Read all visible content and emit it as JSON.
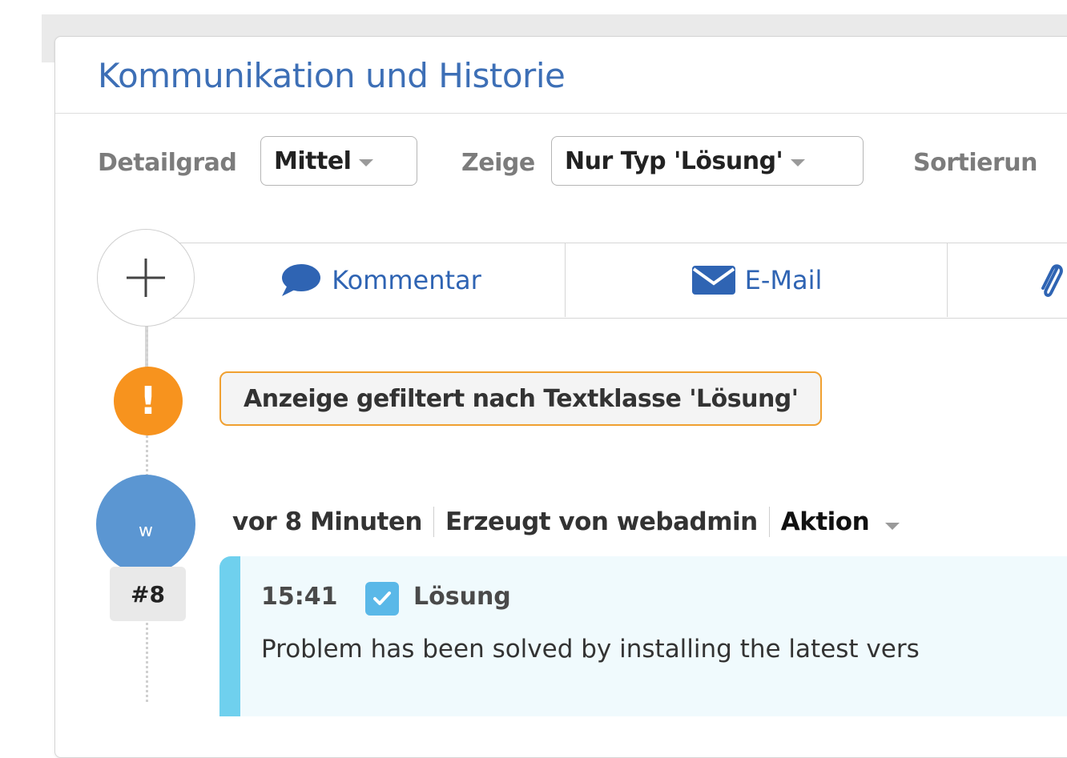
{
  "header": {
    "title": "Kommunikation und Historie"
  },
  "filters": {
    "detail_label": "Detailgrad",
    "detail_value": "Mittel",
    "show_label": "Zeige",
    "show_value": "Nur Typ 'Lösung'",
    "sort_label": "Sortierun"
  },
  "toolbar": {
    "comment_label": "Kommentar",
    "email_label": "E-Mail"
  },
  "notice": {
    "text": "Anzeige gefiltert nach Textklasse 'Lösung'",
    "icon_text": "!"
  },
  "entry": {
    "avatar_initial": "w",
    "number": "#8",
    "relative_time": "vor 8 Minuten",
    "created_by": "Erzeugt von webadmin",
    "action_label": "Aktion",
    "time": "15:41",
    "type": "Lösung",
    "text": "Problem has been solved by installing the latest vers"
  },
  "colors": {
    "accent": "#3d6fb6",
    "warning": "#f7931e",
    "avatar": "#5b96d2",
    "solution_border": "#6fd0ee"
  }
}
